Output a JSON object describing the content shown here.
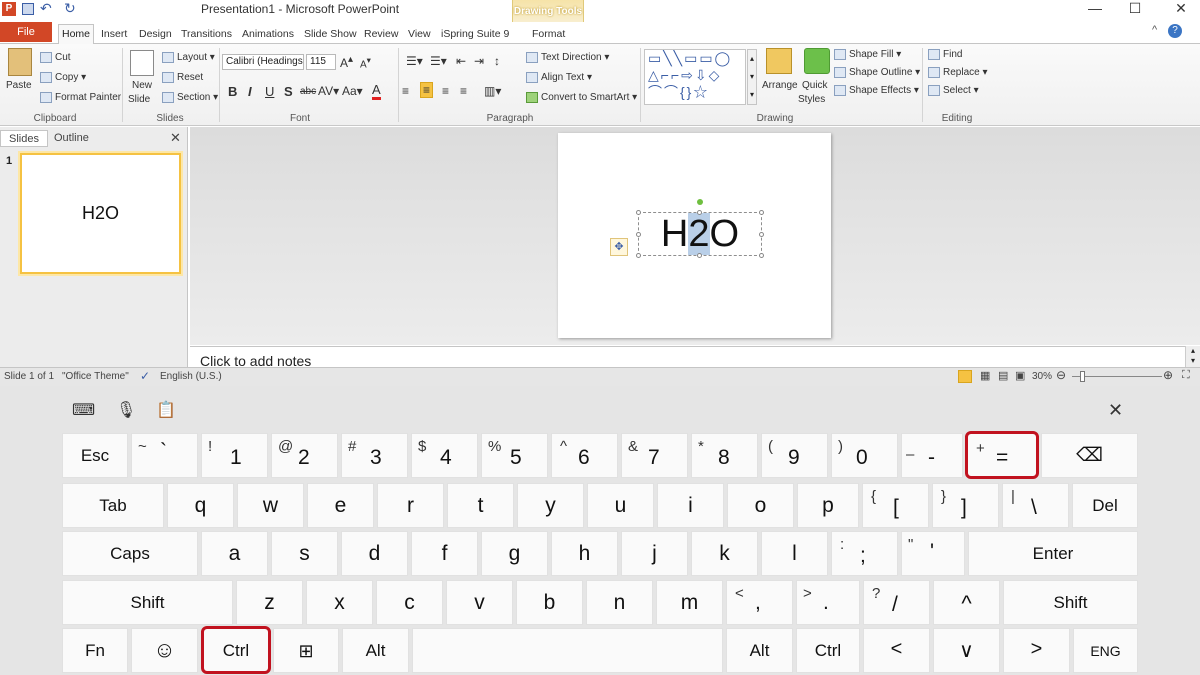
{
  "window": {
    "title": "Presentation1 - Microsoft PowerPoint",
    "context_tab_group": "Drawing Tools",
    "context_tab": "Format"
  },
  "tabs": [
    "Home",
    "Insert",
    "Design",
    "Transitions",
    "Animations",
    "Slide Show",
    "Review",
    "View",
    "iSpring Suite 9"
  ],
  "file_tab": "File",
  "ribbon": {
    "clipboard": {
      "paste": "Paste",
      "cut": "Cut",
      "copy": "Copy",
      "format_painter": "Format Painter",
      "label": "Clipboard"
    },
    "slides": {
      "new_slide_1": "New",
      "new_slide_2": "Slide",
      "layout": "Layout",
      "reset": "Reset",
      "section": "Section",
      "label": "Slides"
    },
    "font": {
      "name": "Calibri (Headings",
      "size": "115",
      "label": "Font"
    },
    "paragraph": {
      "text_direction": "Text Direction",
      "align_text": "Align Text",
      "convert": "Convert to SmartArt",
      "label": "Paragraph"
    },
    "drawing": {
      "arrange": "Arrange",
      "quick_styles_1": "Quick",
      "quick_styles_2": "Styles",
      "shape_fill": "Shape Fill",
      "shape_outline": "Shape Outline",
      "shape_effects": "Shape Effects",
      "label": "Drawing"
    },
    "editing": {
      "find": "Find",
      "replace": "Replace",
      "select": "Select",
      "label": "Editing"
    }
  },
  "panel": {
    "tab_slides": "Slides",
    "tab_outline": "Outline",
    "thumb_number": "1",
    "thumb_text": "H2O"
  },
  "slide": {
    "text_before": "H",
    "text_selected": "2",
    "text_after": "O"
  },
  "notes": {
    "placeholder": "Click to add notes"
  },
  "status": {
    "slide_info": "Slide 1 of 1",
    "theme": "\"Office Theme\"",
    "language": "English (U.S.)",
    "zoom": "30%"
  },
  "keyboard": {
    "row1": [
      {
        "main": "Esc"
      },
      {
        "sec": "~",
        "main": "`"
      },
      {
        "sec": "!",
        "main": "1"
      },
      {
        "sec": "@",
        "main": "2"
      },
      {
        "sec": "#",
        "main": "3"
      },
      {
        "sec": "$",
        "main": "4"
      },
      {
        "sec": "%",
        "main": "5"
      },
      {
        "sec": "^",
        "main": "6"
      },
      {
        "sec": "&",
        "main": "7"
      },
      {
        "sec": "*",
        "main": "8"
      },
      {
        "sec": "(",
        "main": "9"
      },
      {
        "sec": ")",
        "main": "0"
      },
      {
        "sec": "–",
        "main": "-"
      },
      {
        "sec": "+",
        "main": "="
      },
      {
        "main": "⌫"
      }
    ],
    "row2": [
      "Tab",
      "q",
      "w",
      "e",
      "r",
      "t",
      "y",
      "u",
      "i",
      "o",
      "p",
      {
        "sec": "{",
        "main": "["
      },
      {
        "sec": "}",
        "main": "]"
      },
      {
        "sec": "|",
        "main": "\\"
      },
      "Del"
    ],
    "row3": [
      "Caps",
      "a",
      "s",
      "d",
      "f",
      "g",
      "h",
      "j",
      "k",
      "l",
      {
        "sec": ":",
        "main": ";"
      },
      {
        "sec": "\"",
        "main": "'"
      },
      "Enter"
    ],
    "row4": [
      "Shift",
      "z",
      "x",
      "c",
      "v",
      "b",
      "n",
      "m",
      {
        "sec": "<",
        "main": ","
      },
      {
        "sec": ">",
        "main": "."
      },
      {
        "sec": "?",
        "main": "/"
      },
      "^",
      "Shift"
    ],
    "row5": [
      "Fn",
      "☺",
      "Ctrl",
      "⊞",
      "Alt",
      "",
      "Alt",
      "Ctrl",
      "<",
      "∨",
      ">",
      "ENG"
    ],
    "close": "✕"
  }
}
